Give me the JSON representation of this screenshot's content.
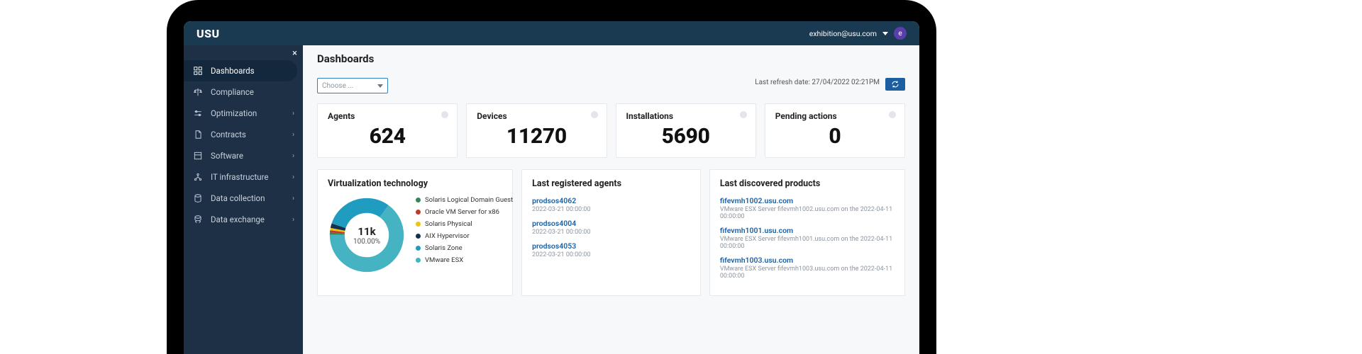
{
  "brand": "USU",
  "user": {
    "email": "exhibition@usu.com",
    "initial": "e"
  },
  "sidebar": {
    "items": [
      {
        "label": "Dashboards",
        "expandable": false,
        "active": true
      },
      {
        "label": "Compliance",
        "expandable": false,
        "active": false
      },
      {
        "label": "Optimization",
        "expandable": true,
        "active": false
      },
      {
        "label": "Contracts",
        "expandable": true,
        "active": false
      },
      {
        "label": "Software",
        "expandable": true,
        "active": false
      },
      {
        "label": "IT infrastructure",
        "expandable": true,
        "active": false
      },
      {
        "label": "Data collection",
        "expandable": true,
        "active": false
      },
      {
        "label": "Data exchange",
        "expandable": true,
        "active": false
      }
    ]
  },
  "page": {
    "title": "Dashboards",
    "choose_placeholder": "Choose ...",
    "refresh_label": "Last refresh date:",
    "refresh_time": "27/04/2022 02:21PM"
  },
  "metrics": [
    {
      "label": "Agents",
      "value": "624"
    },
    {
      "label": "Devices",
      "value": "11270"
    },
    {
      "label": "Installations",
      "value": "5690"
    },
    {
      "label": "Pending actions",
      "value": "0"
    }
  ],
  "chart_data": {
    "type": "pie",
    "title": "Virtualization technology",
    "center_value": "11k",
    "center_pct": "100.00%",
    "series": [
      {
        "name": "Solaris Logical Domain Guest",
        "pct": 1,
        "color": "#2e8b57"
      },
      {
        "name": "Oracle VM Server for x86",
        "pct": 1,
        "color": "#c0392b"
      },
      {
        "name": "Solaris Physical",
        "pct": 1,
        "color": "#f1c40f"
      },
      {
        "name": "AIX Hypervisor",
        "pct": 2,
        "color": "#16324a"
      },
      {
        "name": "Solaris Zone",
        "pct": 30,
        "color": "#209cc0"
      },
      {
        "name": "VMware ESX",
        "pct": 65,
        "color": "#46b3c2"
      }
    ]
  },
  "agents_panel": {
    "title": "Last registered agents",
    "items": [
      {
        "name": "prodsos4062",
        "time": "2022-03-21 00:00:00"
      },
      {
        "name": "prodsos4004",
        "time": "2022-03-21 00:00:00"
      },
      {
        "name": "prodsos4053",
        "time": "2022-03-21 00:00:00"
      }
    ]
  },
  "products_panel": {
    "title": "Last discovered products",
    "items": [
      {
        "name": "fifevmh1002.usu.com",
        "desc": "VMware ESX Server fifevmh1002.usu.com on the 2022-04-11 00:00:00"
      },
      {
        "name": "fifevmh1001.usu.com",
        "desc": "VMware ESX Server fifevmh1001.usu.com on the 2022-04-11 00:00:00"
      },
      {
        "name": "fifevmh1003.usu.com",
        "desc": "VMware ESX Server fifevmh1003.usu.com on the 2022-04-11 00:00:00"
      }
    ]
  }
}
